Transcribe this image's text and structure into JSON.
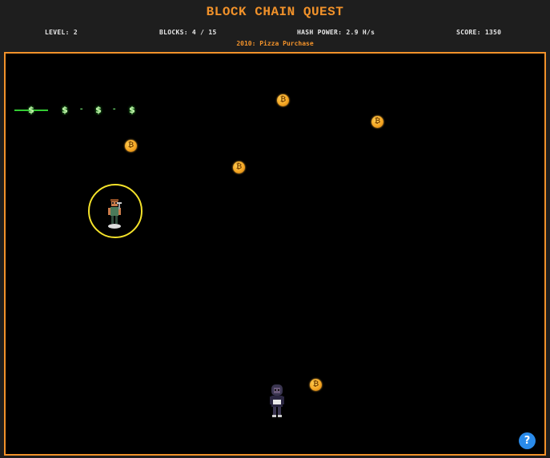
{
  "header": {
    "title": "BLOCK CHAIN QUEST",
    "level": "LEVEL: 2",
    "blocks": "BLOCKS: 4 / 15",
    "hash_power": "HASH POWER: 2.9 H/s",
    "score": "SCORE: 1350",
    "era": "2010: Pizza Purchase"
  },
  "chain": {
    "blocks": [
      "$",
      "$",
      "$",
      "$"
    ],
    "separator": "-"
  },
  "coins": [
    "₿",
    "₿",
    "₿",
    "₿",
    "₿",
    "₿"
  ],
  "help_button": "?",
  "colors": {
    "accent": "#f2922a",
    "coin": "#f5a623",
    "chain": "#33cc33",
    "player_ring": "#f4e22a",
    "help": "#2a8bea"
  },
  "icons": {
    "coin": "bitcoin-coin-icon",
    "player": "miner-character-icon",
    "enemy": "hooded-thief-icon"
  }
}
